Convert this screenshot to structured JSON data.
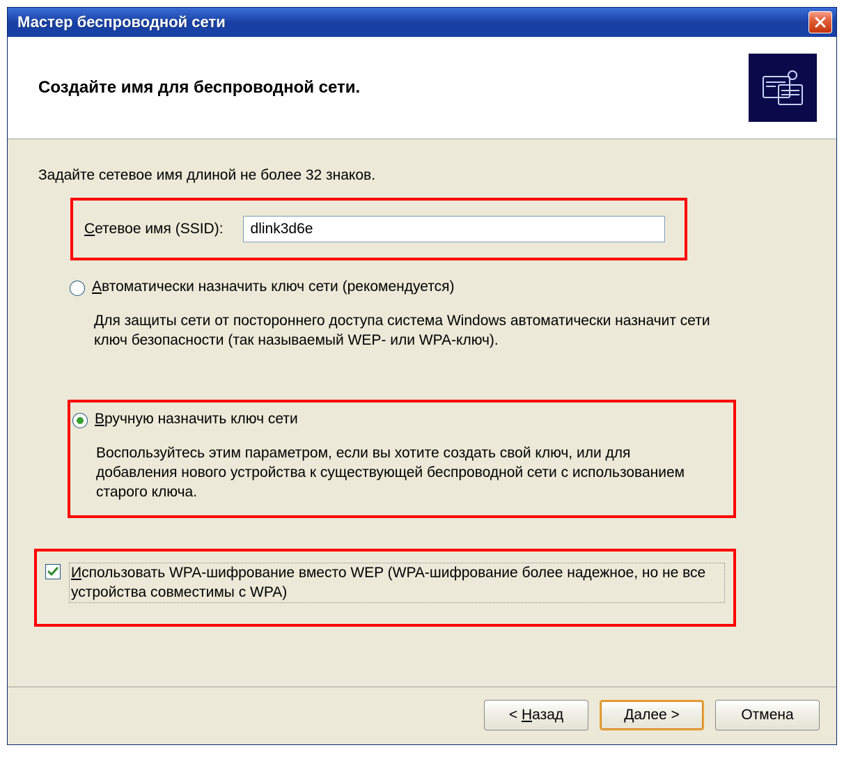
{
  "window": {
    "title": "Мастер беспроводной сети"
  },
  "header": {
    "title": "Создайте имя для беспроводной сети."
  },
  "content": {
    "instruction": "Задайте сетевое имя длиной не более 32 знаков.",
    "ssid_label_before_u": "",
    "ssid_label_u": "С",
    "ssid_label_after_u": "етевое имя (SSID):",
    "ssid_value": "dlink3d6e",
    "auto_radio": {
      "u": "А",
      "rest": "втоматически назначить ключ сети (рекомендуется)",
      "desc": "Для защиты сети от постороннего доступа система Windows автоматически назначит сети ключ безопасности (так называемый WEP- или WPA-ключ).",
      "selected": false
    },
    "manual_radio": {
      "u": "В",
      "rest": "ручную назначить ключ сети",
      "desc": "Воспользуйтесь этим параметром, если вы хотите создать свой ключ, или для добавления нового устройства к существующей беспроводной сети с использованием старого ключа.",
      "selected": true
    },
    "wpa_checkbox": {
      "u": "И",
      "rest": "спользовать WPA-шифрование вместо WEP (WPA-шифрование более надежное, но не все устройства совместимы с WPA)",
      "checked": true
    }
  },
  "buttons": {
    "back_lt": "< ",
    "back_u": "Н",
    "back_rest": "азад",
    "next_u": "Д",
    "next_rest": "алее >",
    "cancel": "Отмена"
  }
}
